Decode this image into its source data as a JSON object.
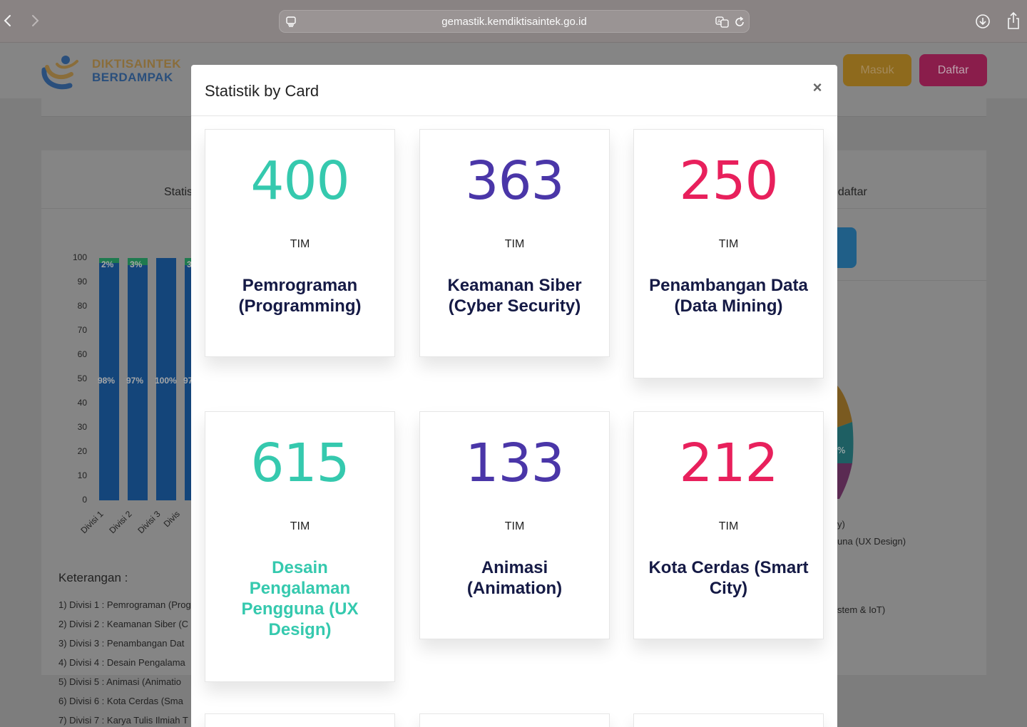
{
  "browser": {
    "url": "gemastik.kemdiktisaintek.go.id"
  },
  "site": {
    "logo_line1": "DIKTISAINTEK",
    "logo_line2": "BERDAMPAK",
    "masuk_label": "Masuk",
    "daftar_label": "Daftar"
  },
  "background": {
    "left_panel_title": "Statis",
    "right_panel_title": "ndaftar",
    "y_ticks": [
      "100",
      "90",
      "80",
      "70",
      "60",
      "50",
      "40",
      "30",
      "20",
      "10",
      "0"
    ],
    "bars": [
      {
        "label": "Divisi 1",
        "main_pct": "98%",
        "top_pct": "2%",
        "value": 98
      },
      {
        "label": "Divisi 2",
        "main_pct": "97%",
        "top_pct": "3%",
        "value": 97
      },
      {
        "label": "Divisi 3",
        "main_pct": "100%",
        "top_pct": "",
        "value": 100
      },
      {
        "label": "Divis",
        "main_pct": "97",
        "top_pct": "3",
        "value": 97
      }
    ],
    "keterangan_title": "Keterangan :",
    "keterangan_items": [
      "1) Divisi 1 : Pemrograman (Prog",
      "2) Divisi 2 : Keamanan Siber (C",
      "3) Divisi 3 : Penambangan Dat",
      "4) Divisi 4 : Desain Pengalama",
      "5) Divisi 5 : Animasi (Animatio",
      "6) Divisi 6 : Kota Cerdas (Sma",
      "7) Divisi 7 : Karya Tulis Ilmiah T"
    ],
    "right_legend": [
      "y)",
      "una (UX Design)",
      "stem & IoT)"
    ],
    "pie_label": "%"
  },
  "modal": {
    "title": "Statistik by Card",
    "close_symbol": "×",
    "cards": [
      {
        "count": "400",
        "unit": "TIM",
        "name": "Pemrograman (Programming)",
        "count_color": "#35c9ae",
        "name_color": "#151a45"
      },
      {
        "count": "363",
        "unit": "TIM",
        "name": "Keamanan Siber (Cyber Security)",
        "count_color": "#4a36a8",
        "name_color": "#151a45"
      },
      {
        "count": "250",
        "unit": "TIM",
        "name": "Penambangan Data (Data Mining)",
        "count_color": "#e8205c",
        "name_color": "#151a45"
      },
      {
        "count": "615",
        "unit": "TIM",
        "name": "Desain Pengalaman Pengguna (UX Design)",
        "count_color": "#35c9ae",
        "name_color": "#35c9ae"
      },
      {
        "count": "133",
        "unit": "TIM",
        "name": "Animasi (Animation)",
        "count_color": "#4a36a8",
        "name_color": "#151a45"
      },
      {
        "count": "212",
        "unit": "TIM",
        "name": "Kota Cerdas (Smart City)",
        "count_color": "#e8205c",
        "name_color": "#151a45"
      }
    ]
  }
}
